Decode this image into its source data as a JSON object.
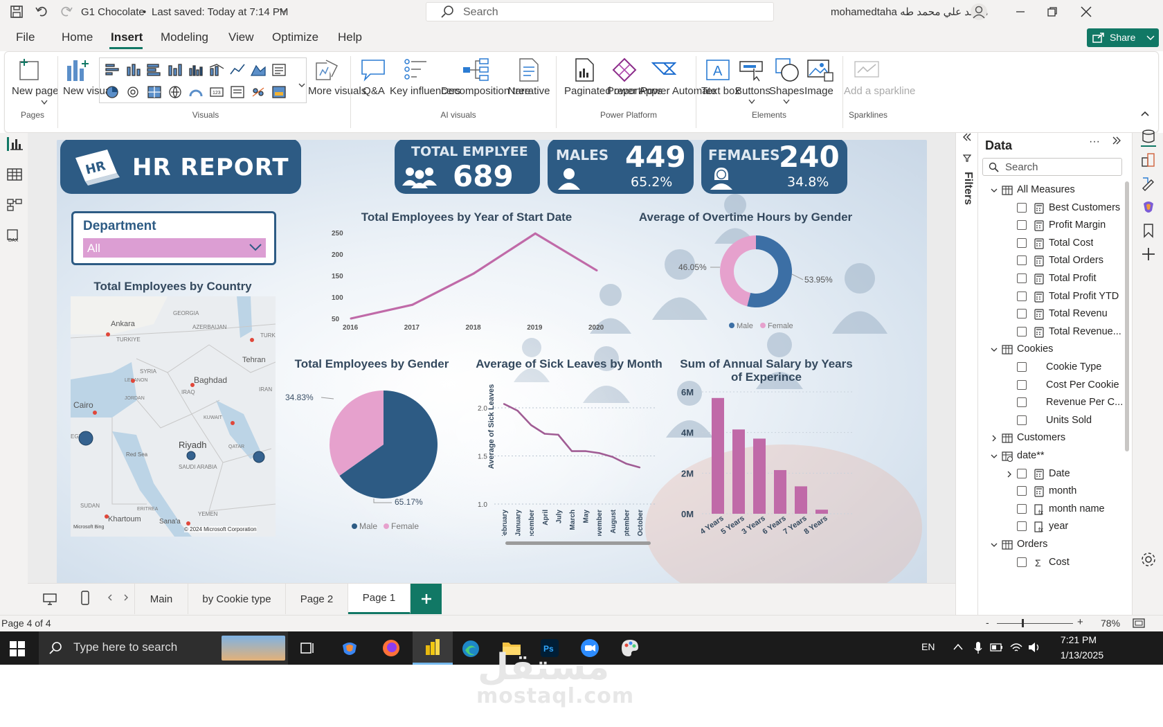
{
  "titlebar": {
    "file_title": "G1 Chocolate",
    "saved": "Last saved: Today at 7:14 PM",
    "search_placeholder": "Search",
    "user": "mohamedtaha محمد علي محمد طه"
  },
  "menu": {
    "file": "File",
    "home": "Home",
    "insert": "Insert",
    "modeling": "Modeling",
    "view": "View",
    "optimize": "Optimize",
    "help": "Help",
    "share": "Share"
  },
  "ribbon": {
    "new_page": "New page",
    "new_visual": "New visual",
    "more_visuals": "More visuals",
    "qa": "Q&A",
    "key_influencers": "Key influencers",
    "decomp_tree": "Decomposition tree",
    "narrative": "Narrative",
    "paginated": "Paginated report",
    "power_apps": "Power Apps",
    "power_automate": "Power Automate",
    "text_box": "Text box",
    "buttons": "Buttons",
    "shapes": "Shapes",
    "image": "Image",
    "sparkline": "Add a sparkline",
    "groups": {
      "pages": "Pages",
      "visuals": "Visuals",
      "ai": "AI visuals",
      "platform": "Power Platform",
      "elements": "Elements",
      "sparklines": "Sparklines"
    }
  },
  "report": {
    "title": "HR REPORT",
    "hr_badge": "HR",
    "total": {
      "label": "TOTAL EMPLYEE",
      "value": "689"
    },
    "males": {
      "label": "MALES",
      "value": "449",
      "pct": "65.2%"
    },
    "females": {
      "label": "FEMALES",
      "value": "240",
      "pct": "34.8%"
    },
    "slicer": {
      "title": "Department",
      "value": "All"
    },
    "map": {
      "title": "Total Employees by Country",
      "labels": [
        "Ankara",
        "TURKIYE",
        "GEORGIA",
        "AZERBAIJAN",
        "TURK",
        "Tehran",
        "SYRIA",
        "LEBANON",
        "Baghdad",
        "IRAQ",
        "IRAN",
        "JORDAN",
        "Cairo",
        "KUWAIT",
        "EGYPT",
        "Riyadh",
        "QATAR",
        "Red Sea",
        "SAUDI ARABIA",
        "SUDAN",
        "ERITREA",
        "YEMEN",
        "Khartoum",
        "Sana'a"
      ],
      "attribution": "© 2024 Microsoft Corporation",
      "bing": "Microsoft Bing"
    }
  },
  "chart_data": [
    {
      "type": "line",
      "title": "Total Employees by Year of Start Date",
      "x": [
        "2016",
        "2017",
        "2018",
        "2019",
        "2020"
      ],
      "values": [
        50,
        82,
        155,
        248,
        162
      ],
      "yticks": [
        "250",
        "200",
        "150",
        "100",
        "50"
      ],
      "color": "#c06aa8"
    },
    {
      "type": "pie",
      "title": "Average of Overtime Hours by Gender",
      "donut": true,
      "series": [
        {
          "name": "Male",
          "value": 53.95,
          "label": "53.95%",
          "color": "#3c6fa5"
        },
        {
          "name": "Female",
          "value": 46.05,
          "label": "46.05%",
          "color": "#e6a1cd"
        }
      ],
      "legend": [
        "Male",
        "Female"
      ]
    },
    {
      "type": "pie",
      "title": "Total Employees by Gender",
      "series": [
        {
          "name": "Male",
          "value": 65.17,
          "label": "65.17%",
          "color": "#2d5b84"
        },
        {
          "name": "Female",
          "value": 34.83,
          "label": "34.83%",
          "color": "#e6a1cd"
        }
      ],
      "legend": [
        "Male",
        "Female"
      ]
    },
    {
      "type": "line",
      "title": "Average of Sick Leaves by Month",
      "ylabel": "Average of Sick Leaves",
      "x": [
        "February",
        "January",
        "December",
        "April",
        "July",
        "March",
        "May",
        "November",
        "August",
        "September",
        "October"
      ],
      "values": [
        2.04,
        1.97,
        1.82,
        1.73,
        1.72,
        1.55,
        1.55,
        1.53,
        1.49,
        1.42,
        1.38
      ],
      "yticks": [
        "2.0",
        "1.5",
        "1.0"
      ],
      "ylim": [
        1.0,
        2.05
      ],
      "color": "#a05c94"
    },
    {
      "type": "bar",
      "title": "Sum of Annual Salary by Years of Experince",
      "categories": [
        "4 Years",
        "5 Years",
        "3 Years",
        "6 Years",
        "7 Years",
        "8 Years"
      ],
      "values": [
        5700000,
        4150000,
        3700000,
        2150000,
        1350000,
        200000
      ],
      "yticks": [
        "6M",
        "4M",
        "2M",
        "0M"
      ],
      "ylim": [
        0,
        6000000
      ],
      "color": "#c06aa8"
    }
  ],
  "filters": {
    "label": "Filters"
  },
  "data_pane": {
    "title": "Data",
    "search": "Search",
    "items": [
      {
        "label": "All Measures",
        "level": 0,
        "kind": "table",
        "exp": "open"
      },
      {
        "label": "Best Customers",
        "level": 1,
        "kind": "measure"
      },
      {
        "label": "Profit Margin",
        "level": 1,
        "kind": "measure"
      },
      {
        "label": "Total Cost",
        "level": 1,
        "kind": "measure"
      },
      {
        "label": "Total Orders",
        "level": 1,
        "kind": "measure"
      },
      {
        "label": "Total Profit",
        "level": 1,
        "kind": "measure"
      },
      {
        "label": "Total Profit YTD",
        "level": 1,
        "kind": "measure"
      },
      {
        "label": "Total Revenu",
        "level": 1,
        "kind": "measure"
      },
      {
        "label": "Total Revenue...",
        "level": 1,
        "kind": "measure"
      },
      {
        "label": "Cookies",
        "level": 0,
        "kind": "table",
        "exp": "open"
      },
      {
        "label": "Cookie Type",
        "level": 1,
        "kind": "field"
      },
      {
        "label": "Cost Per Cookie",
        "level": 1,
        "kind": "field"
      },
      {
        "label": "Revenue Per C...",
        "level": 1,
        "kind": "field"
      },
      {
        "label": "Units Sold",
        "level": 1,
        "kind": "field"
      },
      {
        "label": "Customers",
        "level": 0,
        "kind": "table",
        "exp": "closed"
      },
      {
        "label": "date**",
        "level": 0,
        "kind": "datetable",
        "exp": "open"
      },
      {
        "label": "Date",
        "level": 1,
        "kind": "measure",
        "exp": "closed"
      },
      {
        "label": "month",
        "level": 1,
        "kind": "measure"
      },
      {
        "label": "month name",
        "level": 1,
        "kind": "calc"
      },
      {
        "label": "year",
        "level": 1,
        "kind": "calc"
      },
      {
        "label": "Orders",
        "level": 0,
        "kind": "table",
        "exp": "open"
      },
      {
        "label": "Cost",
        "level": 1,
        "kind": "sigma"
      }
    ]
  },
  "tabs": [
    "Main",
    "by Cookie type",
    "Page 2",
    "Page 1"
  ],
  "status": {
    "page": "Page 4 of 4",
    "zoom": "78%"
  },
  "taskbar": {
    "search": "Type here to search",
    "lang": "EN",
    "time": "7:21 PM",
    "date": "1/13/2025"
  },
  "watermark": {
    "arabic": "مستقل",
    "domain": "mostaql.com"
  }
}
